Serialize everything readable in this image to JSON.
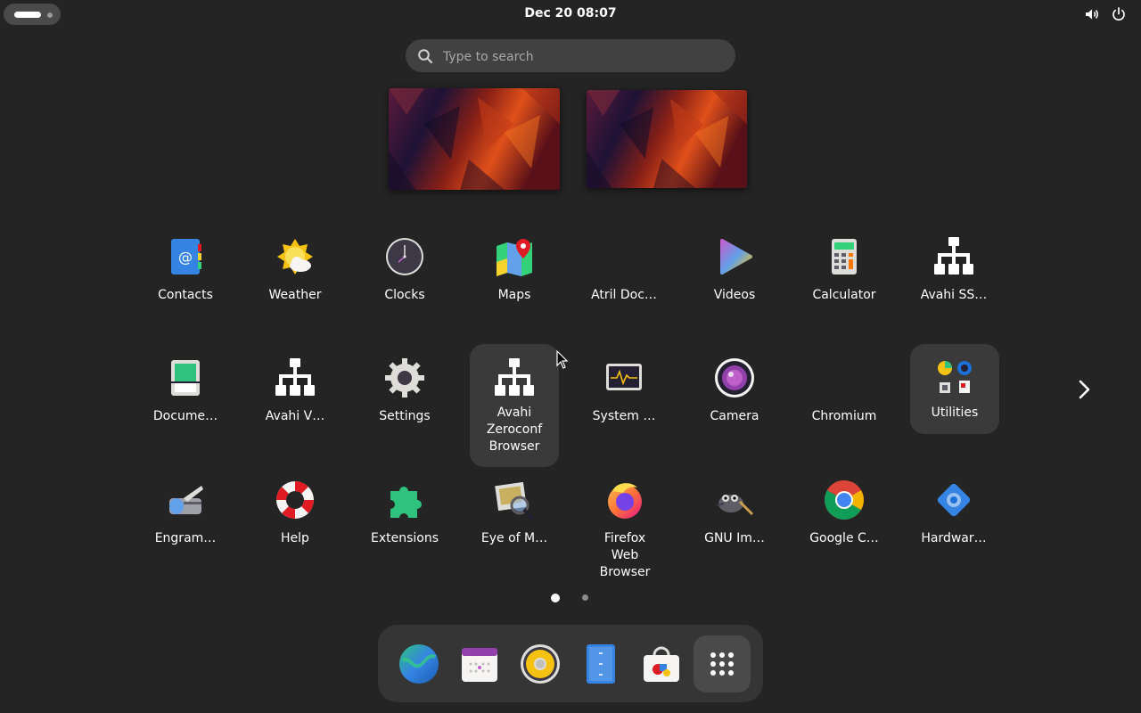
{
  "topbar": {
    "datetime": "Dec 20  08:07",
    "icons": [
      "activities-indicator",
      "volume-icon",
      "power-icon"
    ]
  },
  "search": {
    "placeholder": "Type to search",
    "value": ""
  },
  "apps": [
    {
      "label": "Contacts",
      "icon": "contacts-icon"
    },
    {
      "label": "Weather",
      "icon": "weather-icon"
    },
    {
      "label": "Clocks",
      "icon": "clocks-icon"
    },
    {
      "label": "Maps",
      "icon": "maps-icon"
    },
    {
      "label": "Atril Doc…",
      "icon": "atril-document-viewer-icon"
    },
    {
      "label": "Videos",
      "icon": "videos-icon"
    },
    {
      "label": "Calculator",
      "icon": "calculator-icon"
    },
    {
      "label": "Avahi SS…",
      "icon": "network-icon"
    },
    {
      "label": "Docume…",
      "icon": "document-scanner-icon"
    },
    {
      "label": "Avahi V…",
      "icon": "network-icon"
    },
    {
      "label": "Settings",
      "icon": "gear-icon"
    },
    {
      "label": "Avahi\nZeroconf\nBrowser",
      "icon": "network-icon"
    },
    {
      "label": "System …",
      "icon": "system-monitor-icon"
    },
    {
      "label": "Camera",
      "icon": "camera-icon"
    },
    {
      "label": "Chromium",
      "icon": "chromium-icon"
    },
    {
      "label": "Utilities",
      "icon": "utilities-folder-icon"
    },
    {
      "label": "Engram…",
      "icon": "engrampa-icon"
    },
    {
      "label": "Help",
      "icon": "help-lifebuoy-icon"
    },
    {
      "label": "Extensions",
      "icon": "puzzle-icon"
    },
    {
      "label": "Eye of M…",
      "icon": "image-viewer-icon"
    },
    {
      "label": "Firefox\nWeb\nBrowser",
      "icon": "firefox-icon"
    },
    {
      "label": "GNU Im…",
      "icon": "gimp-icon"
    },
    {
      "label": "Google C…",
      "icon": "chrome-icon"
    },
    {
      "label": "Hardwar…",
      "icon": "hardware-icon"
    }
  ],
  "pager": {
    "pages": 2,
    "current": 1
  },
  "dash": [
    {
      "name": "web-browser",
      "icon": "globe-icon"
    },
    {
      "name": "calendar",
      "icon": "calendar-icon"
    },
    {
      "name": "rhythmbox",
      "icon": "speaker-icon"
    },
    {
      "name": "text-editor",
      "icon": "text-editor-icon"
    },
    {
      "name": "software",
      "icon": "software-bag-icon"
    },
    {
      "name": "show-apps",
      "icon": "app-grid-icon"
    }
  ]
}
